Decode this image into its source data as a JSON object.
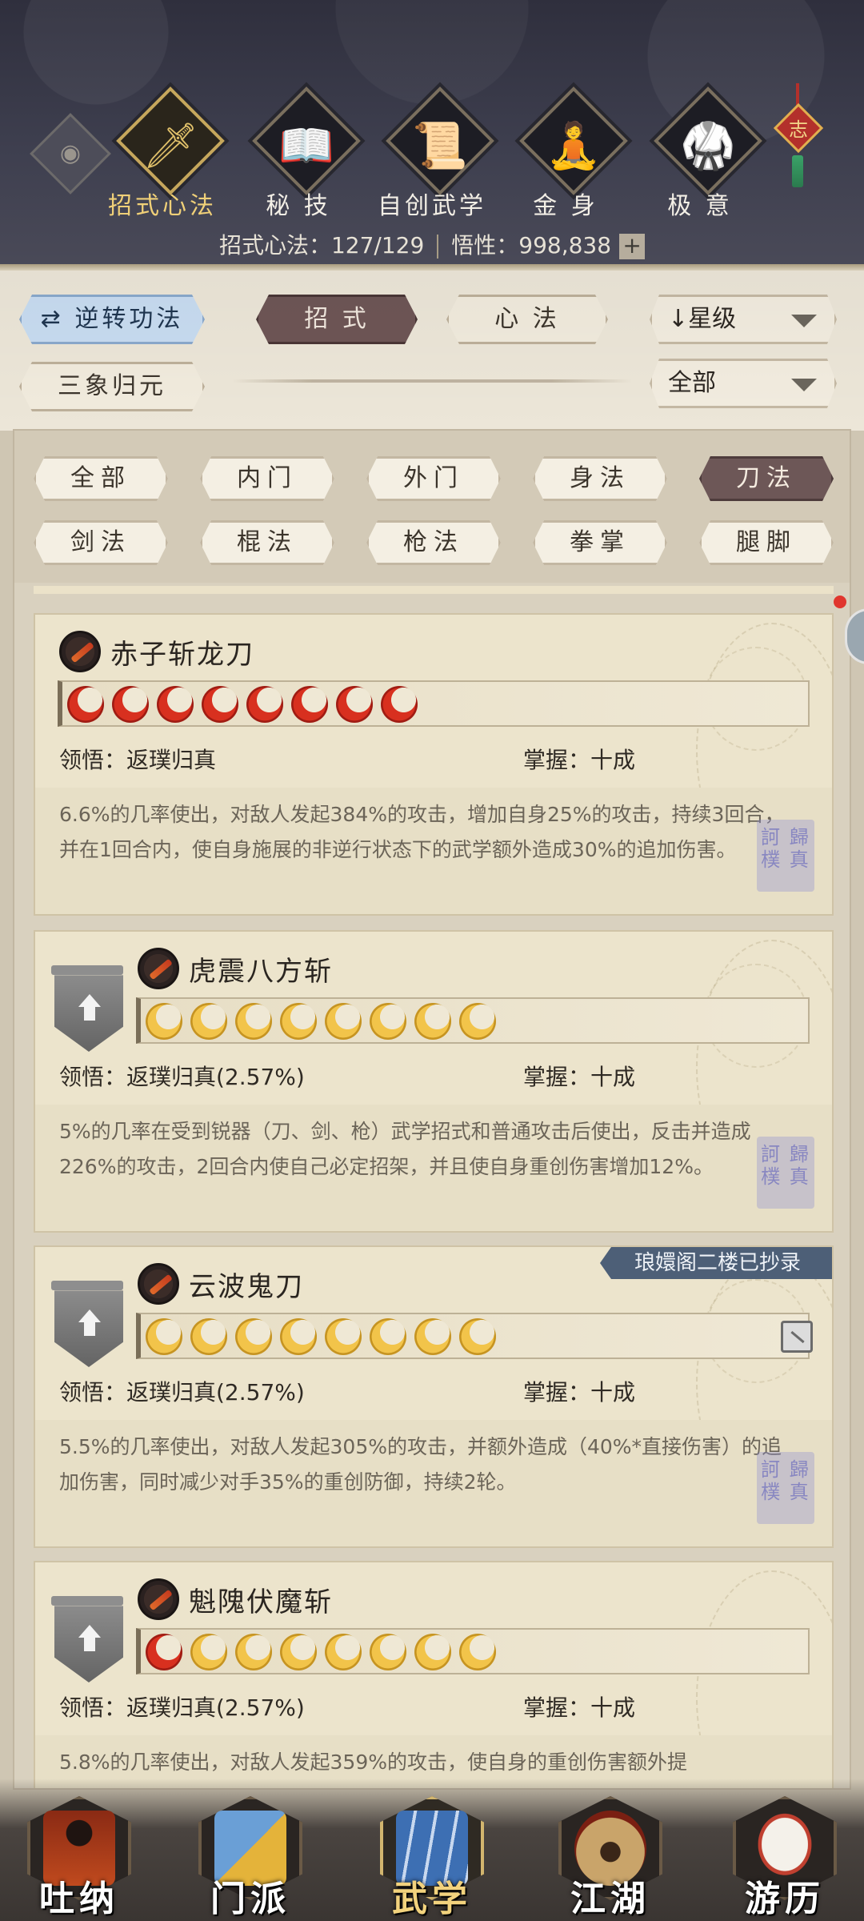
{
  "header": {
    "eye_icon": "eye-icon",
    "categories": [
      {
        "label": "招式心法",
        "icon": "sword-icon",
        "glyph": "🗡",
        "active": true
      },
      {
        "label": "秘 技",
        "icon": "book-icon",
        "glyph": "📖",
        "active": false
      },
      {
        "label": "自创武学",
        "icon": "scroll-brush-icon",
        "glyph": "📜",
        "active": false
      },
      {
        "label": "金 身",
        "icon": "meditation-icon",
        "glyph": "🧘",
        "active": false
      },
      {
        "label": "极 意",
        "icon": "martial-stance-icon",
        "glyph": "🥋",
        "active": false
      }
    ],
    "ornament_char": "志",
    "stats": {
      "moves_label": "招式心法：127/129",
      "insight_label": "悟性：998,838",
      "plus": "+"
    }
  },
  "toolbar": {
    "reverse_btn": "逆转功法",
    "moves_tab": "招 式",
    "mind_tab": "心 法",
    "sort_dropdown": "星级",
    "sanxiang_btn": "三象归元",
    "filter_dropdown": "全部"
  },
  "filters": {
    "row1": [
      "全部",
      "内门",
      "外门",
      "身法",
      "刀法"
    ],
    "row2": [
      "剑法",
      "棍法",
      "枪法",
      "拳掌",
      "腿脚"
    ],
    "active": "刀法"
  },
  "skills": [
    {
      "name": "赤子斩龙刀",
      "stars": [
        "red",
        "red",
        "red",
        "red",
        "red",
        "red",
        "red",
        "red"
      ],
      "comprehension": "领悟：返璞归真",
      "mastery": "掌握：十成",
      "description": "6.6%的几率使出，对敌人发起384%的攻击，增加自身25%的攻击，持续3回合，并在1回合内，使自身施展的非逆行状态下的武学额外造成30%的追加伤害。",
      "seal": "訶 歸 樸 真"
    },
    {
      "name": "虎震八方斩",
      "stars": [
        "gold",
        "gold",
        "gold",
        "gold",
        "gold",
        "gold",
        "gold",
        "gold"
      ],
      "comprehension": "领悟：返璞归真(2.57%)",
      "mastery": "掌握：十成",
      "description": "5%的几率在受到锐器（刀、剑、枪）武学招式和普通攻击后使出，反击并造成226%的攻击，2回合内使自己必定招架，并且使自身重创伤害增加12%。",
      "seal": "訶 歸 樸 真"
    },
    {
      "name": "云波鬼刀",
      "stars": [
        "gold",
        "gold",
        "gold",
        "gold",
        "gold",
        "gold",
        "gold",
        "gold"
      ],
      "comprehension": "领悟：返璞归真(2.57%)",
      "mastery": "掌握：十成",
      "description": "5.5%的几率使出，对敌人发起305%的攻击，并额外造成（40%*直接伤害）的追加伤害，同时减少对手35%的重创防御，持续2轮。",
      "ribbon": "琅嬛阁二楼已抄录",
      "seal": "訶 歸 樸 真"
    },
    {
      "name": "魁隗伏魔斩",
      "stars": [
        "red",
        "gold",
        "gold",
        "gold",
        "gold",
        "gold",
        "gold",
        "gold"
      ],
      "comprehension": "领悟：返璞归真(2.57%)",
      "mastery": "掌握：十成",
      "description": "5.8%的几率使出，对敌人发起359%的攻击，使自身的重创伤害额外提"
    }
  ],
  "bottom_nav": [
    {
      "label": "吐纳",
      "icon": "monk-icon",
      "active": false
    },
    {
      "label": "门派",
      "icon": "sect-banner-icon",
      "active": false
    },
    {
      "label": "武学",
      "icon": "martial-books-icon",
      "active": true
    },
    {
      "label": "江湖",
      "icon": "straw-hat-icon",
      "active": false
    },
    {
      "label": "游历",
      "icon": "white-horse-icon",
      "active": false
    }
  ],
  "colors": {
    "header_bg": "#3e3f4f",
    "active_gold": "#f0d078",
    "active_pill": "#6d5757",
    "ribbon": "#4d5f77",
    "red_star": "#d8301f",
    "gold_star": "#f2c44a"
  }
}
